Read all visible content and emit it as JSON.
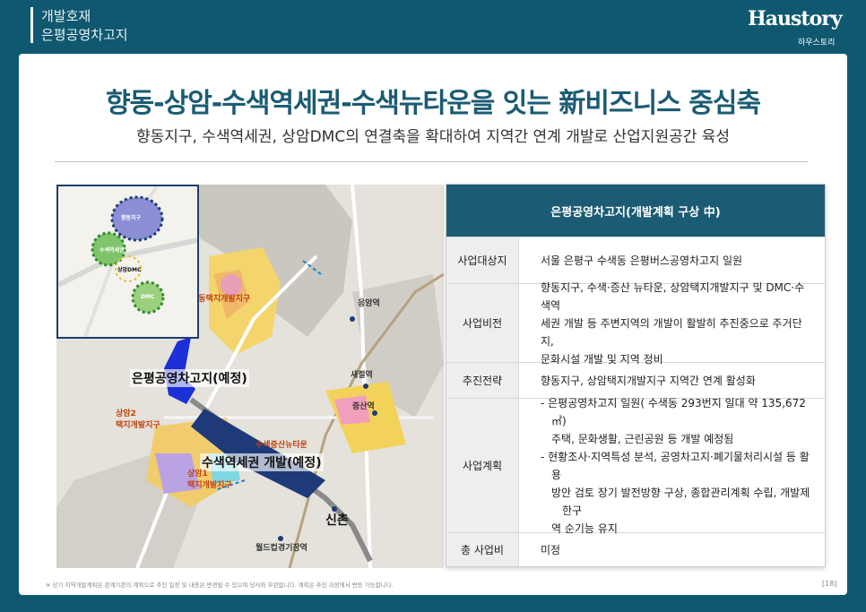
{
  "header": {
    "category": "개발호재",
    "subject": "은평공영차고지",
    "logo_text": "Haustory",
    "logo_sub": "하우스토리"
  },
  "headline": "향동-상암-수색역세권-수색뉴타운을 잇는 新비즈니스 중심축",
  "subhead": "향동지구, 수색역세권, 상암DMC의 연결축을 확대하여 지역간 연계 개발로 산업지원공간 육성",
  "map": {
    "labels": {
      "garage": "은평공영차고지(예정)",
      "susaek_station": "수색역세권 개발(예정)",
      "sinchon": "신촌",
      "hyangdong": "향동택지개발지구",
      "sangam2": "상암2\n택지개발지구",
      "sangam1": "상암1\n택지개발지구",
      "susaek_newtown": "수색증산뉴타운",
      "eungam": "응암역",
      "saejeol": "새절역",
      "jeungsan": "증산역",
      "worldcup": "월드컵경기장역"
    },
    "inset_labels": {
      "a": "향동지구",
      "b": "수색역세권",
      "c": "상암DMC",
      "d": "DMC"
    }
  },
  "table": {
    "title": "은평공영차고지(개발계획 구상 中)",
    "rows": [
      {
        "key": "사업대상지",
        "lines": [
          "서울 은평구 수색동 은평버스공영차고지 일원"
        ]
      },
      {
        "key": "사업비전",
        "lines": [
          "향동지구, 수색·증산 뉴타운, 상암택지개발지구 및 DMC·수색역",
          "세권 개발 등 주변지역의 개발이 활발히 추진중으로 주거단지,",
          "문화시설 개발 및 지역 정비"
        ]
      },
      {
        "key": "추진전략",
        "lines": [
          "향동지구, 상암택지개발지구 지역간 연계 활성화"
        ]
      },
      {
        "key": "사업계획",
        "bullet1": [
          "-  은평공영차고지 일원( 수색동 293번지 일대 약 135,672㎡)",
          "주택, 문화생활, 근린공원 등 개발 예정됨"
        ],
        "bullet2": [
          "-  현황조사·지역특성 분석, 공영차고지·폐기물처리시설 등 활용",
          "방안 검토 장기 발전방향 구상, 종합관리계획 수립, 개발제한구",
          "역 순기능 유지"
        ]
      },
      {
        "key": "총 사업비",
        "lines": [
          "미정"
        ]
      }
    ]
  },
  "footnote": "※ 상기 지역개발계획은 관계기관의 계획으로 추진 일정 및 내용은 변경될 수 있으며 당사와 무관합니다. 계획은 추진 과정에서 변동 가능합니다.",
  "page_number": "[18]",
  "colors": {
    "brand": "#1b5b73",
    "background": "#0f5870",
    "garage_blue": "#1d2fd6",
    "station_navy": "#1f3a78"
  }
}
